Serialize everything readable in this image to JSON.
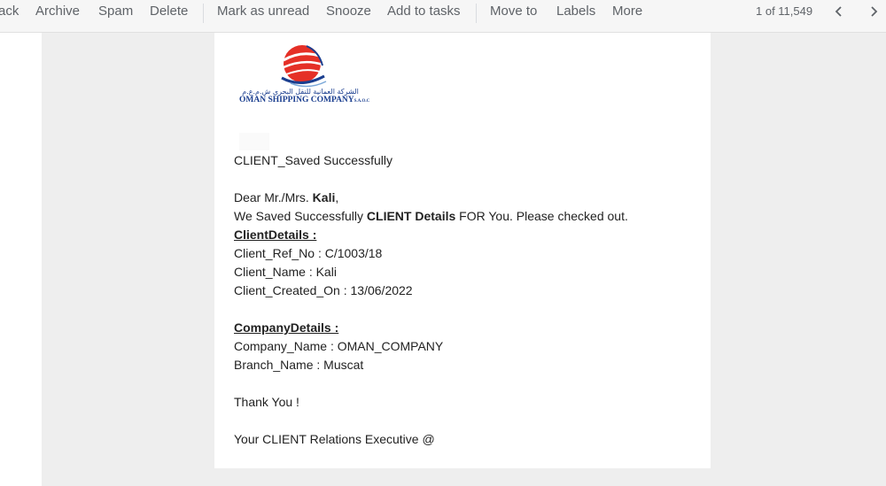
{
  "toolbar": {
    "back_label": "ack",
    "archive_label": "Archive",
    "spam_label": "Spam",
    "delete_label": "Delete",
    "mark_unread_label": "Mark as unread",
    "snooze_label": "Snooze",
    "add_tasks_label": "Add to tasks",
    "move_to_label": "Move to",
    "labels_label": "Labels",
    "more_label": "More",
    "count": "1 of 11,549",
    "prev_icon": "chevron-left-icon",
    "next_icon": "chevron-right-icon"
  },
  "logo": {
    "arabic": "الشركة العمانية للنقل البحري ش.م.ع.م",
    "name": "OMAN SHIPPING COMPANY",
    "suffix": "S.A.O.C",
    "colors": {
      "globe": "#e53027",
      "swoosh": "#1a3e8f"
    }
  },
  "email": {
    "subject_line": "CLIENT_Saved Successfully",
    "greeting_prefix": "Dear Mr./Mrs. ",
    "greeting_name": "Kali",
    "greeting_suffix": ",",
    "intro_prefix": "We Saved Successfully ",
    "intro_bold": "CLIENT Details",
    "intro_suffix": " FOR You. Please checked out.",
    "client_heading": "ClientDetails :",
    "client_ref": "Client_Ref_No : C/1003/18",
    "client_name": "Client_Name : Kali",
    "client_created": "Client_Created_On : 13/06/2022",
    "company_heading": "CompanyDetails :",
    "company_name": "Company_Name : OMAN_COMPANY",
    "branch_name": "Branch_Name : Muscat",
    "thanks": "Thank You !",
    "signature": "Your CLIENT Relations Executive @"
  }
}
